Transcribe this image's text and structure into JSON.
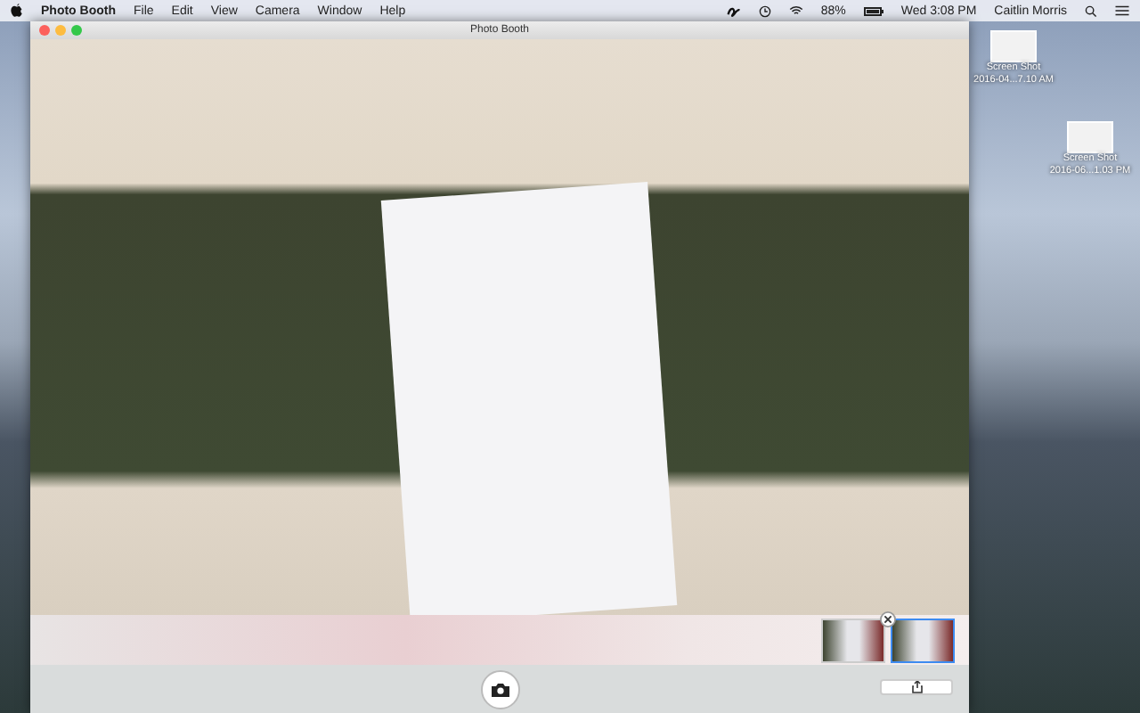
{
  "menu_bar": {
    "app_name": "Photo Booth",
    "menus": [
      "File",
      "Edit",
      "View",
      "Camera",
      "Window",
      "Help"
    ],
    "battery": "88%",
    "clock": "Wed 3:08 PM",
    "user": "Caitlin Morris"
  },
  "window": {
    "title": "Photo Booth"
  },
  "thumbnails": [
    {
      "selected": false
    },
    {
      "selected": true
    }
  ],
  "desktop_icons": [
    {
      "name": "Screen Shot",
      "detail": "2016-04...7.10 AM"
    },
    {
      "name": "Screen Shot",
      "detail": "2016-06...1.03 PM"
    }
  ]
}
